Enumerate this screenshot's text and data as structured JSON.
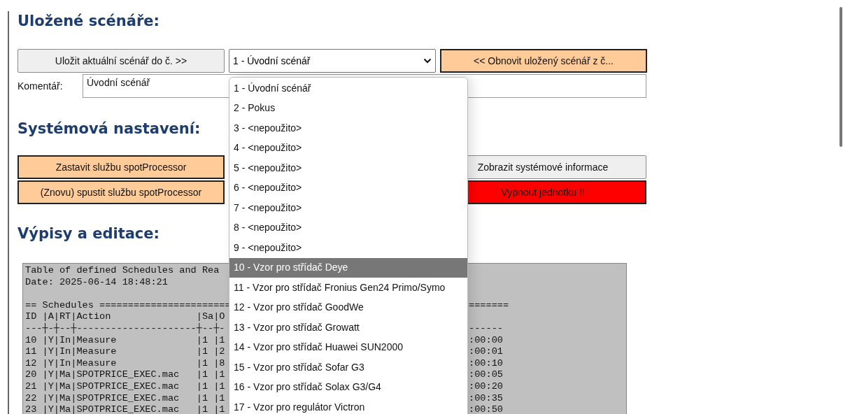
{
  "saved_scenarios": {
    "heading": "Uložené scénáře:",
    "save_button": {
      "label": "Uložit aktuální scénář do č. >>",
      "kind": "light"
    },
    "scenario_select": {
      "value": "1 - Úvodní scénář"
    },
    "restore_button": {
      "label": "<< Obnovit uložený scénář z č...",
      "kind": "accent"
    },
    "comment_label": "Komentář:",
    "comment_value": "Úvodní scénář"
  },
  "system_settings": {
    "heading": "Systémová nastavení:",
    "rows": [
      {
        "left": {
          "label": "Zastavit službu spotProcessor",
          "kind": "accent"
        },
        "right": {
          "label": "Zobrazit systémové informace",
          "kind": "light"
        }
      },
      {
        "left": {
          "label": "(Znovu) spustit službu spotProcessor",
          "kind": "accent"
        },
        "right": {
          "label": "Vypnout jednotku !!",
          "kind": "danger"
        }
      }
    ]
  },
  "listings": {
    "heading": "Výpisy a editace:",
    "lines": [
      {
        "kind": "text",
        "left": "Table of defined Schedules and Rea"
      },
      {
        "kind": "text",
        "left": "Date: 2025-06-14 18:48:21"
      },
      {
        "kind": "blank"
      },
      {
        "kind": "text",
        "left": "== Schedules =======================",
        "right": "======="
      },
      {
        "kind": "text",
        "left": "ID |A|RT|Action               |Sa|O"
      },
      {
        "kind": "text",
        "left": "---┼-┼--┼---------------------┼--┼-",
        "right": "------"
      },
      {
        "kind": "text",
        "left": "10 |Y|In|Measure              |1 |1",
        "right": ":00:00"
      },
      {
        "kind": "text",
        "left": "11 |Y|In|Measure              |1 |2",
        "right": ":00:01"
      },
      {
        "kind": "text",
        "left": "12 |Y|In|Measure              |1 |8",
        "right": ":00:10"
      },
      {
        "kind": "text",
        "left": "20 |Y|Ma|SPOTPRICE_EXEC.mac   |1 |1",
        "right": ":00:05"
      },
      {
        "kind": "text",
        "left": "21 |Y|Ma|SPOTPRICE_EXEC.mac   |1 |1",
        "right": ":00:20"
      },
      {
        "kind": "text",
        "left": "22 |Y|Ma|SPOTPRICE_EXEC.mac   |1 |1",
        "right": ":00:35"
      },
      {
        "kind": "text",
        "left": "23 |Y|Ma|SPOTPRICE_EXEC.mac   |1 |1",
        "right": ":00:50"
      }
    ]
  },
  "dropdown": {
    "options": [
      {
        "label": "1 - Úvodní scénář",
        "highlighted": false
      },
      {
        "label": "2 - Pokus",
        "highlighted": false
      },
      {
        "label": "3 - <nepoužito>",
        "highlighted": false
      },
      {
        "label": "4 - <nepoužito>",
        "highlighted": false
      },
      {
        "label": "5 - <nepoužito>",
        "highlighted": false
      },
      {
        "label": "6 - <nepoužito>",
        "highlighted": false
      },
      {
        "label": "7 - <nepoužito>",
        "highlighted": false
      },
      {
        "label": "8 - <nepoužito>",
        "highlighted": false
      },
      {
        "label": "9 - <nepoužito>",
        "highlighted": false
      },
      {
        "label": "10 - Vzor pro střídač Deye",
        "highlighted": true
      },
      {
        "label": "11 - Vzor pro střídač Fronius Gen24 Primo/Symo",
        "highlighted": false
      },
      {
        "label": "12 - Vzor pro střídač GoodWe",
        "highlighted": false
      },
      {
        "label": "13 - Vzor pro střídač Growatt",
        "highlighted": false
      },
      {
        "label": "14 - Vzor pro střídač Huawei SUN2000",
        "highlighted": false
      },
      {
        "label": "15 - Vzor pro střídač Sofar G3",
        "highlighted": false
      },
      {
        "label": "16 - Vzor pro střídač Solax G3/G4",
        "highlighted": false
      },
      {
        "label": "17 - Vzor pro regulátor Victron",
        "highlighted": false
      }
    ]
  }
}
